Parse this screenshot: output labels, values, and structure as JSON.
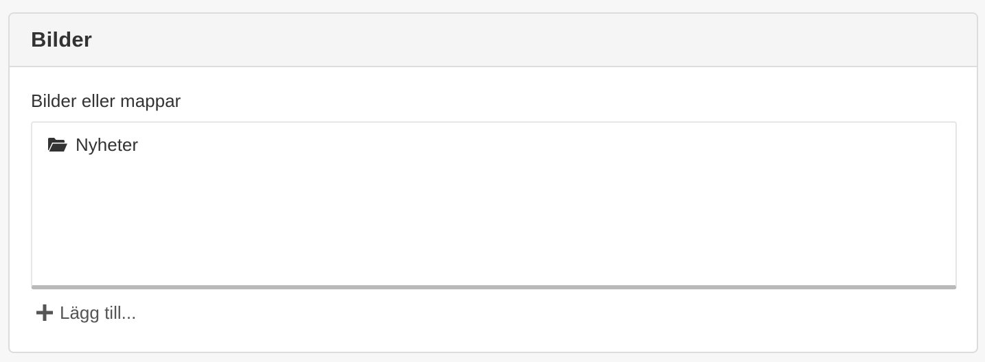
{
  "panel": {
    "title": "Bilder"
  },
  "field": {
    "label": "Bilder eller mappar"
  },
  "items": [
    {
      "label": "Nyheter",
      "icon": "folder-open-icon"
    }
  ],
  "actions": {
    "add_label": "Lägg till...",
    "add_icon": "plus-icon"
  },
  "colors": {
    "text": "#333333",
    "header_bg": "#f5f5f5",
    "border": "#dcdcdc",
    "list_bottom_border": "#b9b9b9"
  }
}
